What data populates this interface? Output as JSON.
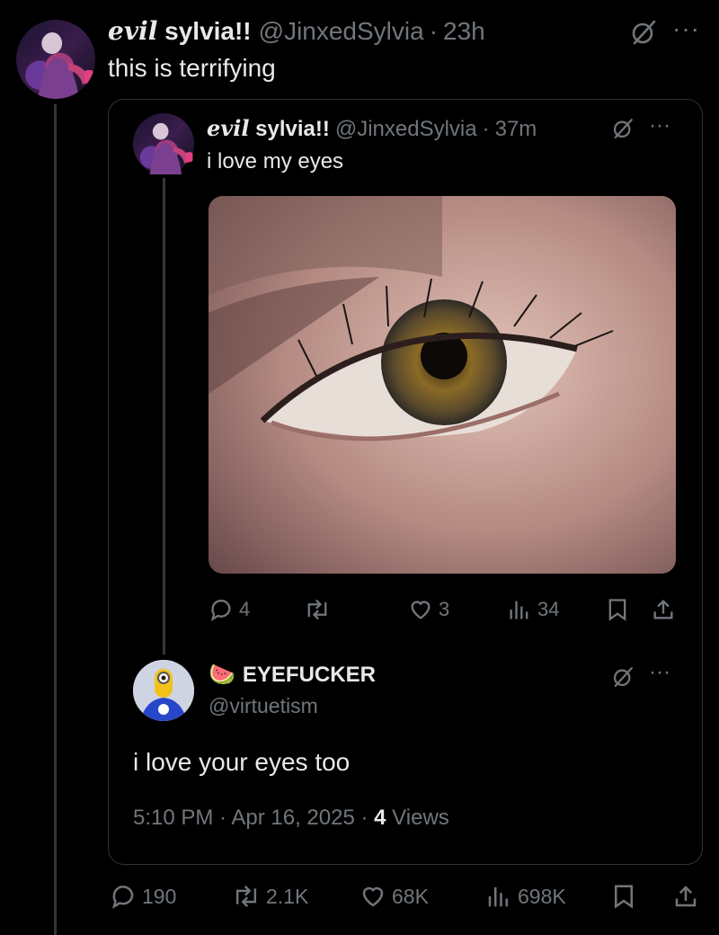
{
  "outer_tweet": {
    "display_name_fancy": "evil",
    "display_name": " sylvia!!",
    "handle": "@JinxedSylvia",
    "separator": "·",
    "time": "23h",
    "text": "this is terrifying",
    "more": "···",
    "actions": {
      "replies": "190",
      "reposts": "2.1K",
      "likes": "68K",
      "views": "698K"
    }
  },
  "quoted_tweet": {
    "display_name_fancy": "evil",
    "display_name": " sylvia!!",
    "handle": "@JinxedSylvia",
    "separator": "·",
    "time": "37m",
    "text": "i love my eyes",
    "more": "···",
    "actions": {
      "replies": "4",
      "reposts": "",
      "likes": "3",
      "views": "34"
    }
  },
  "reply_tweet": {
    "emoji": "🍉",
    "display_name": "EYEFUCKER",
    "handle": "@virtuetism",
    "more": "···",
    "text": "i love your eyes too",
    "timestamp": "5:10 PM · Apr 16, 2025 · ",
    "views_count": "4",
    "views_label": " Views"
  },
  "colors": {
    "background": "#000000",
    "text": "#e7e9ea",
    "muted": "#71767b",
    "border": "#2f3336"
  }
}
